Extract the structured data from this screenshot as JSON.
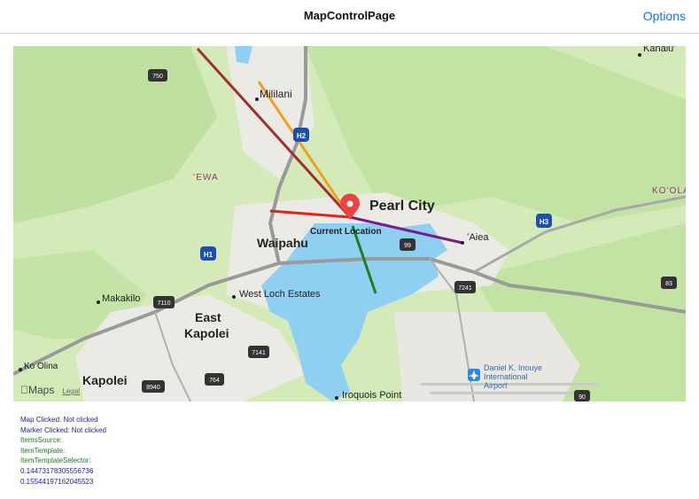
{
  "navbar": {
    "title": "MapControlPage",
    "options_label": "Options"
  },
  "map": {
    "labels": {
      "mililani": "Mililani",
      "ewa": "ʻEWA",
      "pearl_city": "Pearl City",
      "current_location": "Current Location",
      "aiea": "ʻAiea",
      "waipahu": "Waipahu",
      "west_loch_estates": "West Loch Estates",
      "makakilo": "Makakilo",
      "east": "East",
      "kapolei_east": "Kapolei",
      "ko_olina": "Ko Olina",
      "kapolei": "Kapolei",
      "iroquois_point": "Iroquois Point",
      "airport_line1": "Daniel K. Inouye",
      "airport_line2": "International",
      "airport_line3": "Airport",
      "koolau": "KOʻOLA",
      "kahalu": "Kahaluʻ"
    },
    "shields": {
      "r750": "750",
      "h2": "H2",
      "h1": "H1",
      "h3": "H3",
      "r99": "99",
      "r7241": "7241",
      "r7110": "7110",
      "r7141": "7141",
      "r764": "764",
      "r8940": "8940",
      "r83": "83",
      "r90": "90"
    },
    "attribution": {
      "brand": "Maps",
      "legal": "Legal"
    },
    "line_colors": {
      "brown": "#a0302a",
      "orange": "#f0a020",
      "red": "#e8201c",
      "purple": "#7b1a8c",
      "green": "#1e7d1e"
    }
  },
  "status": {
    "map_clicked": "Map Clicked: Not clicked",
    "marker_clicked": "Marker Clicked: Not clicked",
    "items_source": "ItemsSource:",
    "item_template": "ItemTemplate:",
    "item_template_selector": "ItemTemplateSelector:",
    "value1": "0.14473178305556736",
    "value2": "0.15544197162045523"
  }
}
